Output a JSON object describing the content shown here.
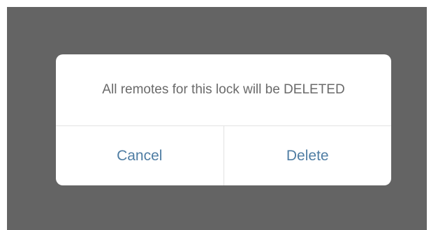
{
  "dialog": {
    "message": "All remotes for this lock will be DELETED",
    "cancel_label": "Cancel",
    "delete_label": "Delete"
  },
  "colors": {
    "overlay": "#646464",
    "dialog_background": "#ffffff",
    "message_text": "#6a6a6a",
    "action_text": "#4f7da3"
  }
}
